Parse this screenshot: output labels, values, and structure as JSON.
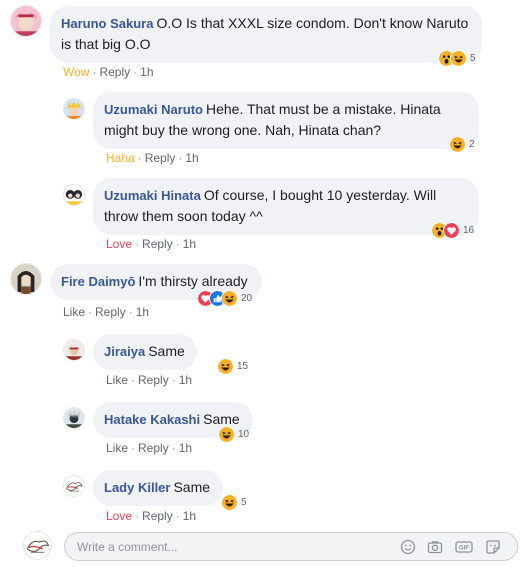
{
  "comments": [
    {
      "author": "Haruno Sakura",
      "text": "O.O Is that XXXL size condom. Don't know Naruto is that big O.O",
      "reaction_label": "Wow",
      "reply": "Reply",
      "time": "1h",
      "reaction_count": "5",
      "reaction_icons": [
        "wow-icon",
        "haha-icon"
      ]
    },
    {
      "author": "Uzumaki Naruto",
      "text": "Hehe. That must be a mistake. Hinata might buy the wrong one. Nah, Hinata chan?",
      "reaction_label": "Haha",
      "reply": "Reply",
      "time": "1h",
      "reaction_count": "2",
      "reaction_icons": [
        "haha-icon"
      ]
    },
    {
      "author": "Uzumaki Hinata",
      "text": "Of course, I bought 10 yesterday. Will throw them soon today ^^",
      "reaction_label": "Love",
      "reply": "Reply",
      "time": "1h",
      "reaction_count": "16",
      "reaction_icons": [
        "wow-icon",
        "love-icon"
      ]
    },
    {
      "author": "Fire Daimyō",
      "text": "I'm thirsty already",
      "reaction_label": "Like",
      "reply": "Reply",
      "time": "1h",
      "reaction_count": "20",
      "reaction_icons": [
        "love-icon",
        "like-icon",
        "haha-icon"
      ]
    },
    {
      "author": "Jiraiya",
      "text": "Same",
      "reaction_label": "Like",
      "reply": "Reply",
      "time": "1h",
      "reaction_count": "15",
      "reaction_icons": [
        "haha-icon"
      ]
    },
    {
      "author": "Hatake Kakashi",
      "text": "Same",
      "reaction_label": "Like",
      "reply": "Reply",
      "time": "1h",
      "reaction_count": "10",
      "reaction_icons": [
        "haha-icon"
      ]
    },
    {
      "author": "Lady Killer",
      "text": "Same",
      "reaction_label": "Love",
      "reply": "Reply",
      "time": "1h",
      "reaction_count": "5",
      "reaction_icons": [
        "haha-icon"
      ]
    }
  ],
  "composer": {
    "placeholder": "Write a comment...",
    "tools": [
      "emoji-icon",
      "camera-icon",
      "gif-icon",
      "sticker-icon"
    ]
  },
  "colors": {
    "link": "#385898",
    "bubble": "#f0f2f5",
    "wow_haha": "#f7b125",
    "love": "#f33e58",
    "like": "#1877f2"
  },
  "separator": "·"
}
